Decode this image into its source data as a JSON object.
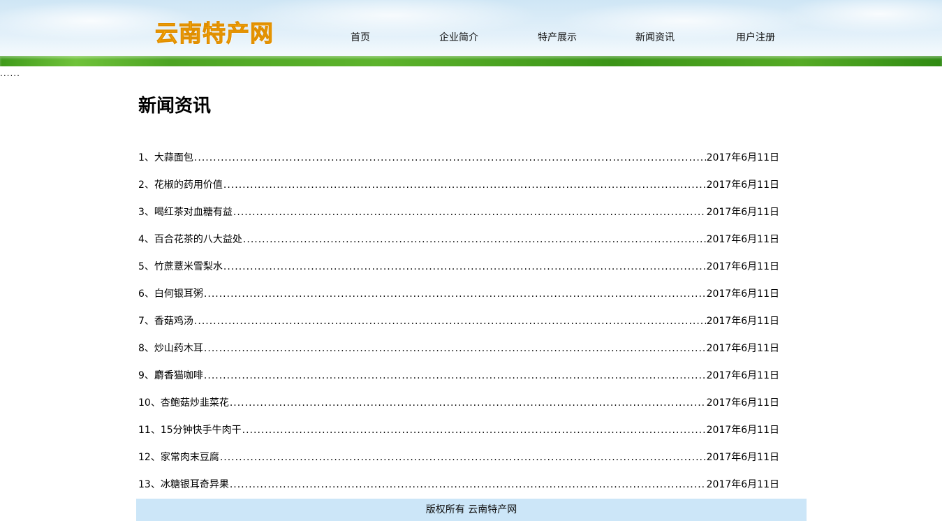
{
  "header": {
    "logo_text": "云南特产网",
    "nav": [
      {
        "label": "首页"
      },
      {
        "label": "企业简介"
      },
      {
        "label": "特产展示"
      },
      {
        "label": "新闻资讯"
      },
      {
        "label": "用户注册"
      }
    ]
  },
  "top_dots": "......",
  "main": {
    "title": "新闻资讯",
    "news": [
      {
        "title": "1、大蒜面包",
        "date": "2017年6月11日"
      },
      {
        "title": "2、花椒的药用价值",
        "date": "2017年6月11日"
      },
      {
        "title": "3、喝红茶对血糖有益",
        "date": "2017年6月11日"
      },
      {
        "title": "4、百合花茶的八大益处",
        "date": "2017年6月11日"
      },
      {
        "title": "5、竹蔗薏米雪梨水",
        "date": "2017年6月11日"
      },
      {
        "title": "6、白何银耳粥",
        "date": "2017年6月11日"
      },
      {
        "title": "7、香菇鸡汤",
        "date": "2017年6月11日"
      },
      {
        "title": "8、炒山药木耳",
        "date": "2017年6月11日"
      },
      {
        "title": "9、麝香猫咖啡",
        "date": "2017年6月11日"
      },
      {
        "title": "10、杏鲍菇炒韭菜花",
        "date": "2017年6月11日"
      },
      {
        "title": "11、15分钟快手牛肉干",
        "date": "2017年6月11日"
      },
      {
        "title": "12、家常肉末豆腐",
        "date": "2017年6月11日"
      },
      {
        "title": "13、冰糖银耳奇异果",
        "date": "2017年6月11日"
      }
    ]
  },
  "footer": {
    "copyright": "版权所有 云南特产网"
  }
}
